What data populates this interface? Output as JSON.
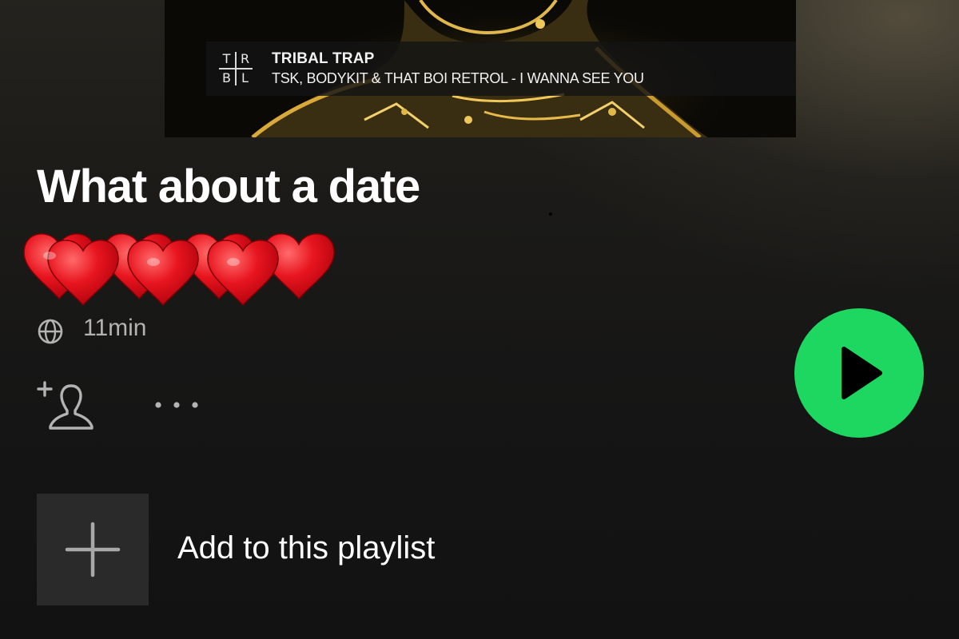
{
  "cover": {
    "logo_letters": [
      "T",
      "R",
      "B",
      "L"
    ],
    "banner_title": "TRIBAL TRAP",
    "banner_subtitle": "TSK, BODYKIT & THAT BOI RETROL - I WANNA SEE YOU"
  },
  "playlist": {
    "title": "What about a date",
    "description_emoji": "❤️❤️❤️❤️❤️❤️❤️",
    "duration": "11min",
    "visibility_icon": "globe-icon"
  },
  "actions": {
    "add_user_icon": "person-plus-icon",
    "more_icon": "more-horizontal-icon",
    "play_icon": "play-icon"
  },
  "add_row": {
    "label": "Add to this playlist",
    "icon": "plus-icon"
  },
  "colors": {
    "background": "#121212",
    "accent_green": "#1ed760",
    "secondary_text": "#b3b3b3",
    "tile": "#2a2a2a"
  }
}
